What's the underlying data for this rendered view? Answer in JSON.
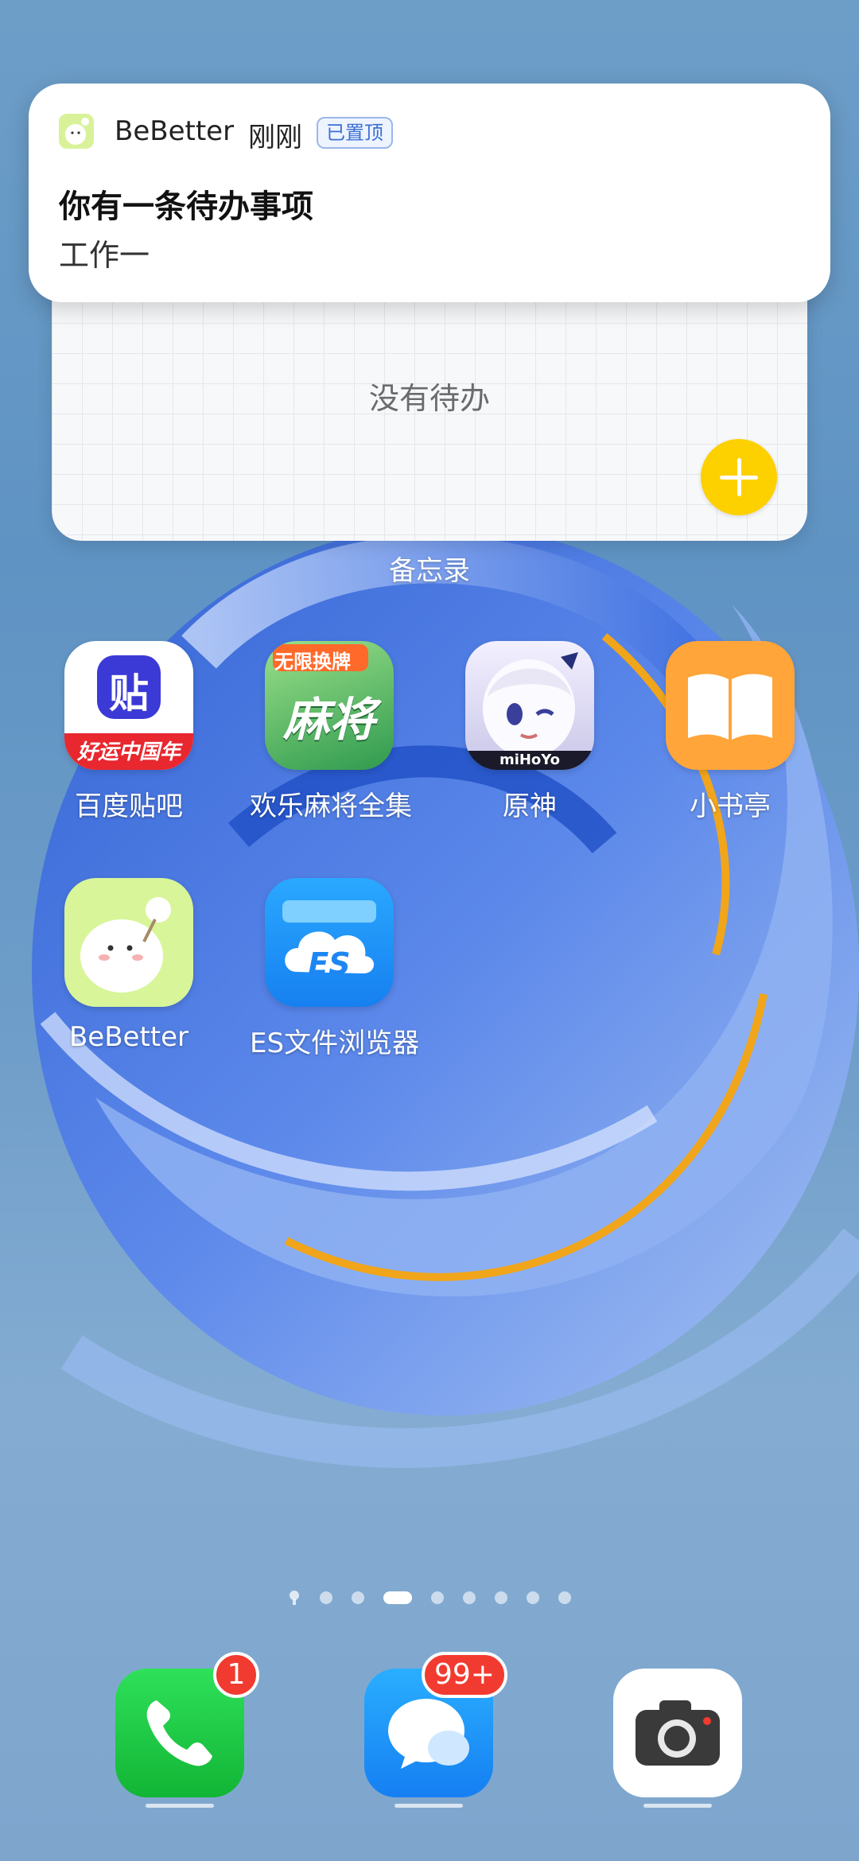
{
  "notification": {
    "app_name": "BeBetter",
    "time": "刚刚",
    "pinned_label": "已置顶",
    "title": "你有一条待办事项",
    "body": "工作一"
  },
  "memo_widget": {
    "empty_text": "没有待办",
    "label": "备忘录"
  },
  "apps": [
    {
      "label": "百度贴吧",
      "icon": "baidu-tieba-icon",
      "icon_text": "贴",
      "banner": "好运中国年"
    },
    {
      "label": "欢乐麻将全集",
      "icon": "mahjong-icon",
      "icon_text": "麻将",
      "banner": "无限换牌"
    },
    {
      "label": "原神",
      "icon": "genshin-icon",
      "banner": "miHoYo"
    },
    {
      "label": "小书亭",
      "icon": "book-icon"
    },
    {
      "label": "BeBetter",
      "icon": "bebetter-icon"
    },
    {
      "label": "ES文件浏览器",
      "icon": "es-file-icon",
      "icon_text": "ES"
    }
  ],
  "page_indicator": {
    "count": 9,
    "active_index": 3
  },
  "dock": {
    "phone": {
      "badge": "1"
    },
    "messages": {
      "badge": "99+"
    }
  },
  "colors": {
    "accent_yellow": "#fdd000",
    "badge_red": "#f23b30",
    "phone_green": "#16c23d",
    "messages_blue": "#1a8cff"
  }
}
